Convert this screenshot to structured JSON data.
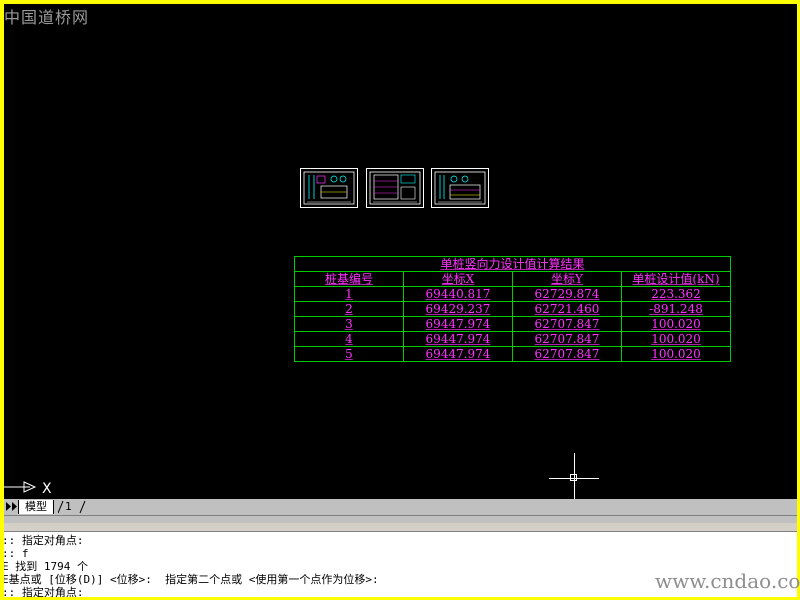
{
  "watermark": {
    "top_text": "中国道桥网",
    "bottom_text": "www.cndao.com"
  },
  "colors": {
    "frame": "#ffff00",
    "canvas": "#000000",
    "table_grid": "#00cc00",
    "table_text": "#ff33ff"
  },
  "table": {
    "title": "单桩竖向力设计值计算结果",
    "headers": [
      "桩基编号",
      "坐标X",
      "坐标Y",
      "单桩设计值(kN)"
    ],
    "rows": [
      [
        "1",
        "69440.817",
        "62729.874",
        "223.362"
      ],
      [
        "2",
        "69429.237",
        "62721.460",
        "-891.248"
      ],
      [
        "3",
        "69447.974",
        "62707.847",
        "100.020"
      ],
      [
        "4",
        "69447.974",
        "62707.847",
        "100.020"
      ],
      [
        "5",
        "69447.974",
        "62707.847",
        "100.020"
      ]
    ]
  },
  "ucs": {
    "axis_label": "X"
  },
  "tabs": {
    "model": "模型",
    "layout1": "1"
  },
  "command_lines": [
    ":: 指定对角点:",
    ":: f",
    "E 找到 1794 个",
    "E基点或 [位移(D)] <位移>:  指定第二个点或 <使用第一个点作为位移>:",
    ":: 指定对角点:"
  ]
}
